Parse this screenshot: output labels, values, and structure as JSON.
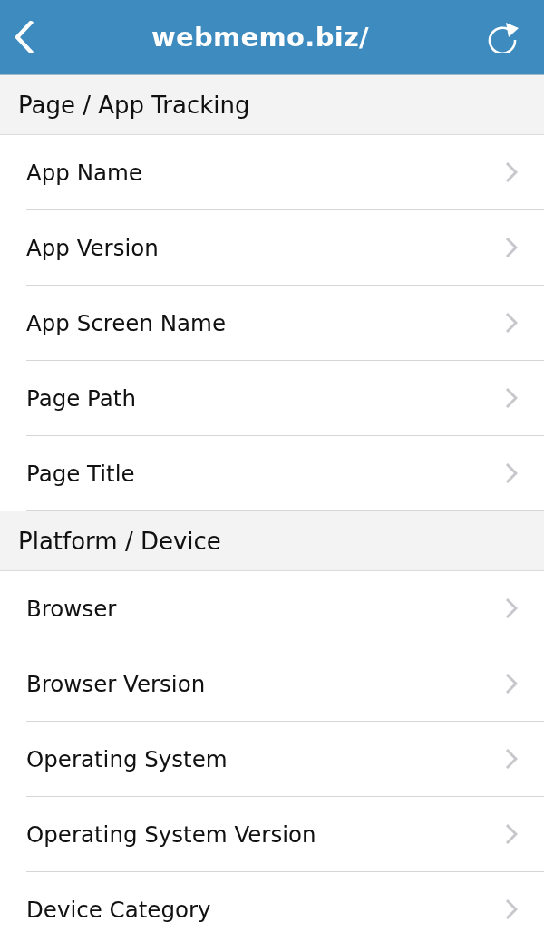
{
  "nav_bar": {
    "title": "webmemo.biz/"
  },
  "sections": [
    {
      "title": "Page / App Tracking",
      "items": [
        {
          "label": "App Name"
        },
        {
          "label": "App Version"
        },
        {
          "label": "App Screen Name"
        },
        {
          "label": "Page Path"
        },
        {
          "label": "Page Title"
        }
      ]
    },
    {
      "title": "Platform / Device",
      "items": [
        {
          "label": "Browser"
        },
        {
          "label": "Browser Version"
        },
        {
          "label": "Operating System"
        },
        {
          "label": "Operating System Version"
        },
        {
          "label": "Device Category"
        }
      ]
    }
  ]
}
